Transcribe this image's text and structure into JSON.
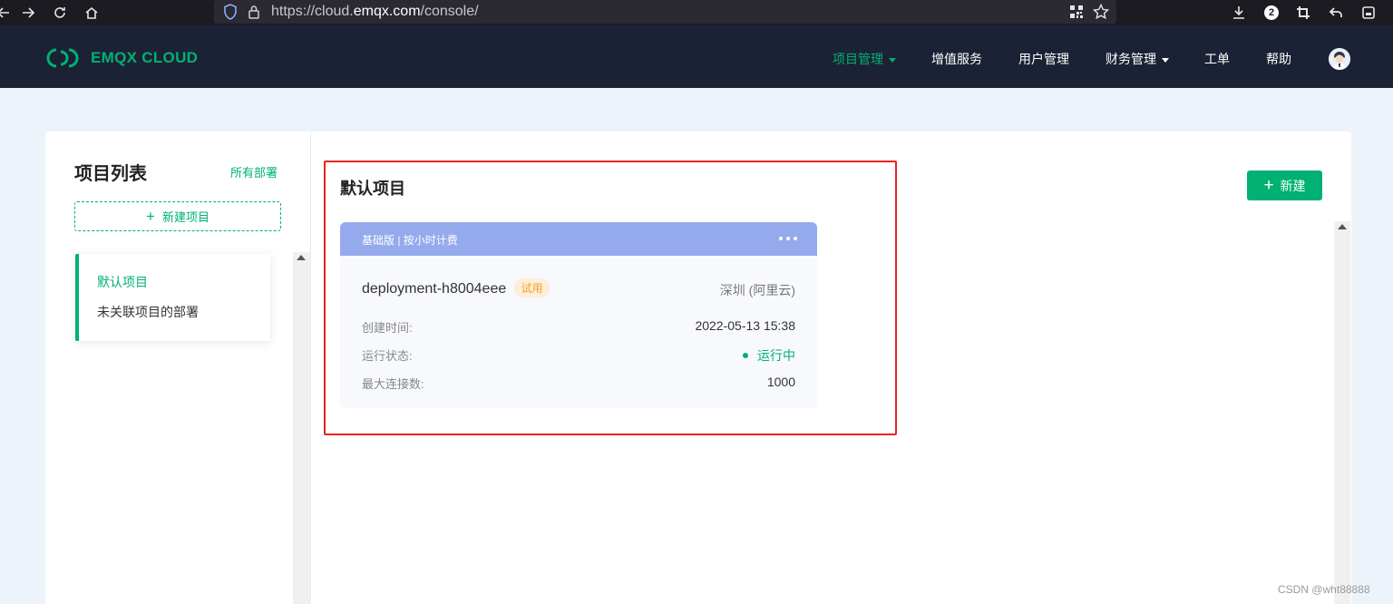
{
  "browser": {
    "url_prefix": "https://cloud.",
    "url_domain": "emqx.com",
    "url_suffix": "/console/",
    "badge_count": "2"
  },
  "header": {
    "logo_text": "EMQX CLOUD",
    "nav": [
      {
        "label": "项目管理",
        "active": true,
        "dropdown": true
      },
      {
        "label": "增值服务"
      },
      {
        "label": "用户管理"
      },
      {
        "label": "财务管理",
        "dropdown": true
      },
      {
        "label": "工单"
      },
      {
        "label": "帮助"
      }
    ]
  },
  "sidebar": {
    "title": "项目列表",
    "all_deployments_link": "所有部署",
    "new_project_label": "新建项目",
    "projects": [
      {
        "label": "默认项目",
        "active": true
      },
      {
        "label": "未关联项目的部署"
      }
    ]
  },
  "main": {
    "section_title": "默认项目",
    "new_button_label": "新建",
    "deployment": {
      "plan": "基础版 | 按小时计费",
      "name": "deployment-h8004eee",
      "badge": "试用",
      "region": "深圳 (阿里云)",
      "rows": [
        {
          "label": "创建时间:",
          "value": "2022-05-13 15:38"
        },
        {
          "label": "运行状态:",
          "value": "运行中"
        },
        {
          "label": "最大连接数:",
          "value": "1000"
        }
      ]
    }
  },
  "watermark": "CSDN @wht88888",
  "colors": {
    "accent": "#00b173",
    "header_bg": "#1c2235",
    "card_header": "#95aaec",
    "highlight_box": "#e8231f"
  }
}
